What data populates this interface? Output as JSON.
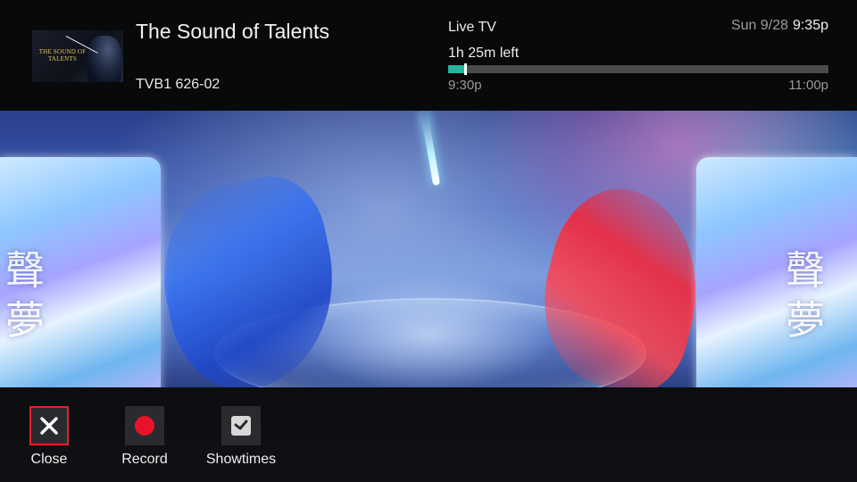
{
  "header": {
    "program_title": "The Sound of Talents",
    "channel": "TVB1 626-02",
    "thumbnail_text": "THE SOUND OF TALENTS",
    "status": "Live TV",
    "time_left": "1h 25m left",
    "progress_fraction": 0.045,
    "start_time": "9:30p",
    "end_time": "11:00p",
    "date": "Sun 9/28",
    "clock": "9:35p"
  },
  "video": {
    "calligraphy_left": "聲\n夢",
    "calligraphy_right": "聲\n夢"
  },
  "actions": [
    {
      "label": "Close",
      "icon": "close-icon",
      "selected": true
    },
    {
      "label": "Record",
      "icon": "record-icon",
      "selected": false
    },
    {
      "label": "Showtimes",
      "icon": "showtimes-icon",
      "selected": false
    }
  ],
  "colors": {
    "accent_progress": "#27b59d",
    "selected_border": "#e3212b",
    "record_red": "#e8132a"
  }
}
